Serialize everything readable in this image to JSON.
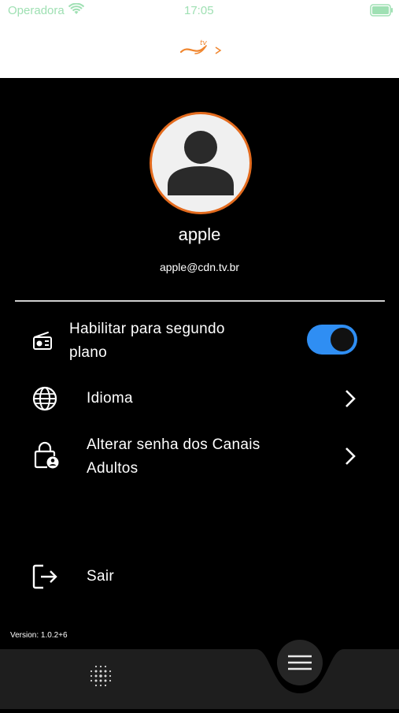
{
  "status": {
    "carrier": "Operadora",
    "time": "17:05"
  },
  "header": {
    "logo_icon": "brand-logo"
  },
  "profile": {
    "name": "apple",
    "email": "apple@cdn.tv.br"
  },
  "settings": [
    {
      "icon": "radio-icon",
      "label": "Habilitar para segundo plano",
      "control": "toggle",
      "toggle_on": true
    },
    {
      "icon": "globe-icon",
      "label": "Idioma",
      "control": "chevron"
    },
    {
      "icon": "lock-person-icon",
      "label": "Alterar senha dos Canais Adultos",
      "control": "chevron"
    },
    {
      "icon": "logout-icon",
      "label": "Sair",
      "control": "none"
    }
  ],
  "footer": {
    "version": "Version: 1.0.2+6"
  },
  "colors": {
    "accent": "#e36b1e",
    "toggle": "#2f8ef3",
    "background": "#000000",
    "bar": "#1e1e1e"
  }
}
